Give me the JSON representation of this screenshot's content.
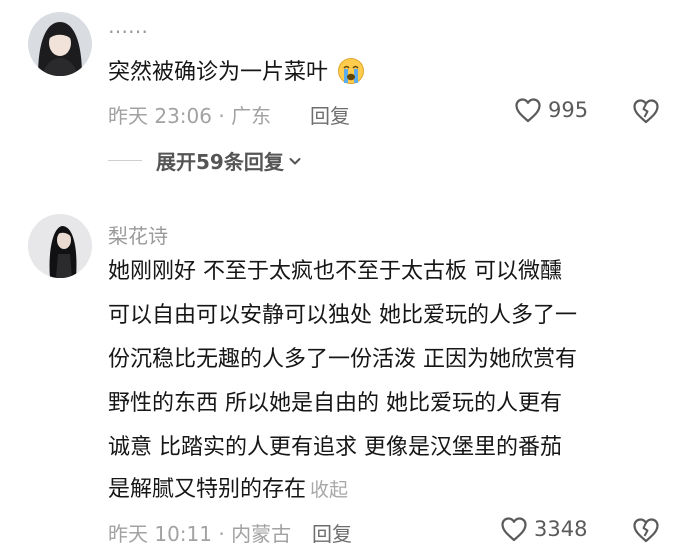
{
  "comments": [
    {
      "username": "……",
      "text": "突然被确诊为一片菜叶",
      "meta": "昨天 23:06 · 广东",
      "reply_label": "回复",
      "like_count": "995",
      "expand_replies": "展开59条回复"
    },
    {
      "username": "梨花诗",
      "lines": [
        "她刚刚好 不至于太疯也不至于太古板 可以微醺",
        "可以自由可以安静可以独处 她比爱玩的人多了一",
        "份沉稳比无趣的人多了一份活泼 正因为她欣赏有",
        "野性的东西 所以她是自由的 她比爱玩的人更有",
        "诚意 比踏实的人更有追求 更像是汉堡里的番茄",
        "是解腻又特别的存在"
      ],
      "collapse_label": "收起",
      "meta": "昨天 10:11 · 内蒙古",
      "reply_label": "回复",
      "like_count": "3348"
    }
  ]
}
